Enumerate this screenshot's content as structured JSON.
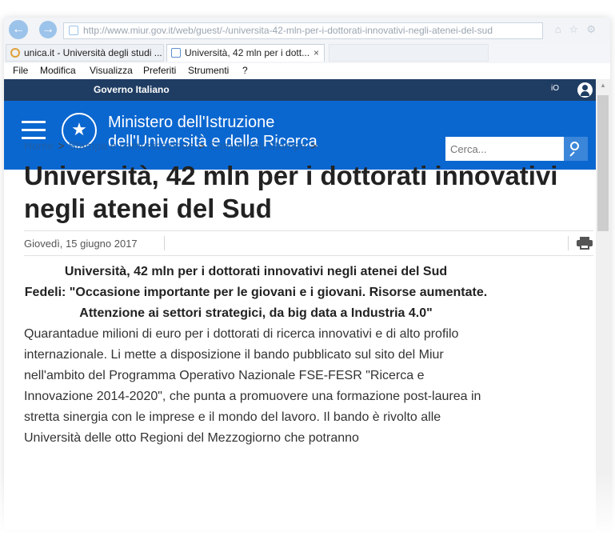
{
  "browser": {
    "address_url": "http://www.miur.gov.it/web/guest/-/universita-42-mln-per-i-dottorati-innovativi-negli-atenei-del-sud",
    "tabs": [
      {
        "label": "unica.it - Università degli studi ...",
        "active": false
      },
      {
        "label": "Università, 42 mln per i dott...",
        "active": true,
        "close": "×"
      }
    ],
    "menu": [
      "File",
      "Modifica",
      "Visualizza",
      "Preferiti",
      "Strumenti",
      "?"
    ]
  },
  "site": {
    "gov_label": "Governo Italiano",
    "lang_label": "iO",
    "ministry_line1": "Ministero dell'Istruzione",
    "ministry_line2": "dell'Università e della Ricerca",
    "search_placeholder": "Cerca...",
    "brand_color": "#0b67d0",
    "topbar_color": "#1f3d63"
  },
  "breadcrumb": [
    "Home",
    "Stampa e comunicazione",
    "Comunicati Stampa"
  ],
  "breadcrumb_sep": ">",
  "article": {
    "title": "Università, 42 mln per i dottorati innovativi negli atenei del Sud",
    "date": "Giovedì, 15 giugno 2017",
    "subheads": [
      "Università, 42 mln per i dottorati innovativi negli atenei del Sud",
      "Fedeli: \"Occasione importante per le giovani e i giovani. Risorse aumentate.",
      "Attenzione ai settori strategici, da big data a Industria 4.0\""
    ],
    "body": "Quarantadue milioni di euro per i dottorati di ricerca innovativi e di alto profilo internazionale. Li mette a disposizione il bando pubblicato sul sito del Miur nell'ambito del Programma Operativo Nazionale FSE-FESR \"Ricerca e Innovazione 2014-2020\", che punta a promuovere una formazione post-laurea in stretta sinergia con le imprese e il mondo del lavoro. Il bando è rivolto alle Università delle otto Regioni del Mezzogiorno che potranno"
  },
  "icons": {
    "back": "back-arrow-icon",
    "forward": "forward-arrow-icon",
    "user": "user-icon",
    "search": "search-icon",
    "print": "print-icon",
    "menu": "hamburger-icon",
    "emblem": "republic-emblem-icon"
  }
}
